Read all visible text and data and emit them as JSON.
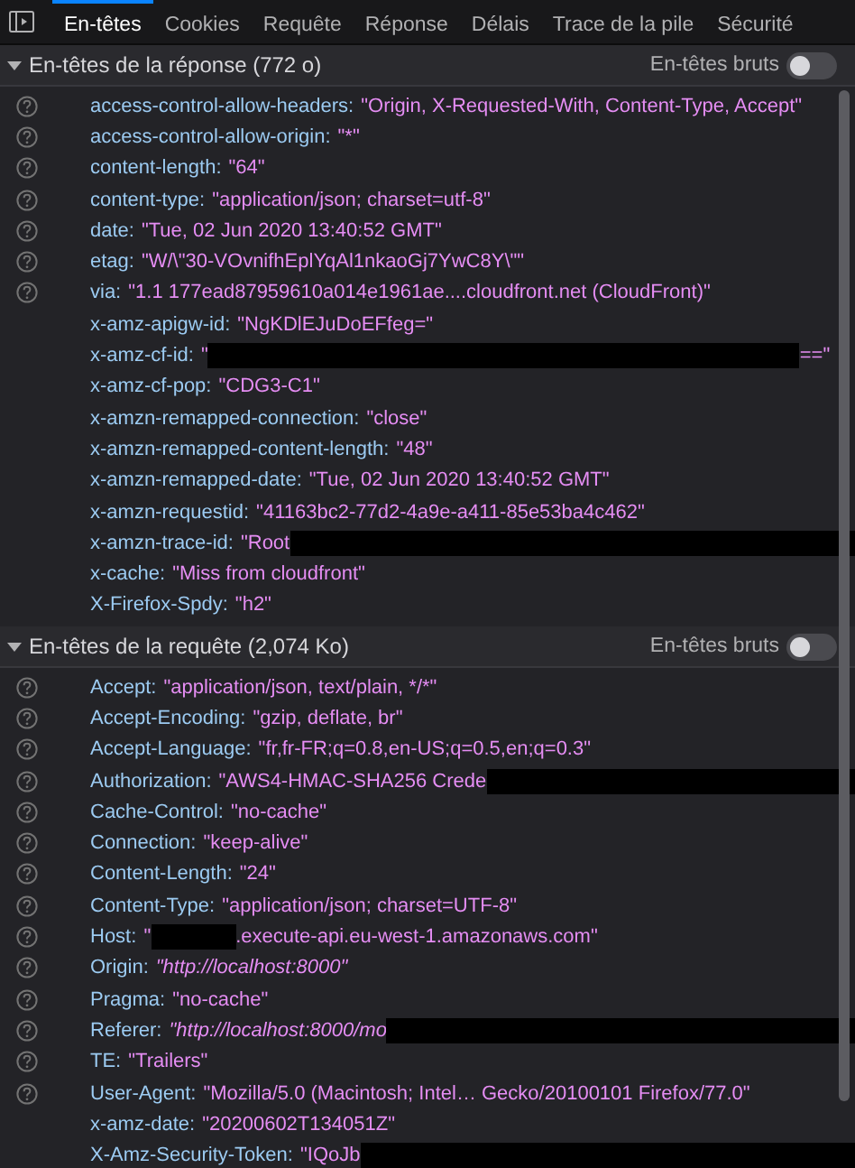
{
  "tabs": [
    {
      "label": "En-têtes",
      "selected": true
    },
    {
      "label": "Cookies",
      "selected": false
    },
    {
      "label": "Requête",
      "selected": false
    },
    {
      "label": "Réponse",
      "selected": false
    },
    {
      "label": "Délais",
      "selected": false
    },
    {
      "label": "Trace de la pile",
      "selected": false
    },
    {
      "label": "Sécurité",
      "selected": false
    }
  ],
  "sections": [
    {
      "title": "En-têtes de la réponse (772 o)",
      "expanded": true,
      "raw_toggle": {
        "label": "En-têtes bruts",
        "on": false
      },
      "headers": [
        {
          "name": "access-control-allow-headers:",
          "value": "\"Origin, X-Requested-With, Content-Type, Accept\"",
          "help": true
        },
        {
          "name": "access-control-allow-origin:",
          "value": "\"*\"",
          "help": true
        },
        {
          "name": "content-length:",
          "value": "\"64\"",
          "help": true
        },
        {
          "name": "content-type:",
          "value": "\"application/json; charset=utf-8\"",
          "help": true
        },
        {
          "name": "date:",
          "value": "\"Tue, 02 Jun 2020 13:40:52 GMT\"",
          "help": true
        },
        {
          "name": "etag:",
          "value": "\"W/\\\"30-VOvnifhEplYqAl1nkaoGj7YwC8Y\\\"\"",
          "help": true
        },
        {
          "name": "via:",
          "value": "\"1.1 177ead87959610a014e1961ae....cloudfront.net (CloudFront)\"",
          "help": true
        },
        {
          "name": "x-amz-apigw-id:",
          "value": "\"NgKDlEJuDoEFfeg=\"",
          "help": false
        },
        {
          "name": "x-amz-cf-id:",
          "value": "\"",
          "kind": "redacted_long",
          "value_tail": "==\"",
          "help": false
        },
        {
          "name": "x-amz-cf-pop:",
          "value": "\"CDG3-C1\"",
          "help": false
        },
        {
          "name": "x-amzn-remapped-connection:",
          "value": "\"close\"",
          "help": false
        },
        {
          "name": "x-amzn-remapped-content-length:",
          "value": "\"48\"",
          "help": false
        },
        {
          "name": "x-amzn-remapped-date:",
          "value": "\"Tue, 02 Jun 2020 13:40:52 GMT\"",
          "help": false
        },
        {
          "name": "x-amzn-requestid:",
          "value": "\"41163bc2-77d2-4a9e-a411-85e53ba4c462\"",
          "help": false
        },
        {
          "name": "x-amzn-trace-id:",
          "value": "\"Root",
          "kind": "redacted_to_edge",
          "help": false
        },
        {
          "name": "x-cache:",
          "value": "\"Miss from cloudfront\"",
          "help": false
        },
        {
          "name": "X-Firefox-Spdy:",
          "value": "\"h2\"",
          "help": false
        }
      ]
    },
    {
      "title": "En-têtes de la requête (2,074 Ko)",
      "expanded": true,
      "raw_toggle": {
        "label": "En-têtes bruts",
        "on": false
      },
      "headers": [
        {
          "name": "Accept:",
          "value": "\"application/json, text/plain, */*\"",
          "help": true
        },
        {
          "name": "Accept-Encoding:",
          "value": "\"gzip, deflate, br\"",
          "help": true
        },
        {
          "name": "Accept-Language:",
          "value": "\"fr,fr-FR;q=0.8,en-US;q=0.5,en;q=0.3\"",
          "help": true
        },
        {
          "name": "Authorization:",
          "value": "\"AWS4-HMAC-SHA256 Crede",
          "kind": "redacted_to_edge",
          "help": true
        },
        {
          "name": "Cache-Control:",
          "value": "\"no-cache\"",
          "help": true
        },
        {
          "name": "Connection:",
          "value": "\"keep-alive\"",
          "help": true
        },
        {
          "name": "Content-Length:",
          "value": "\"24\"",
          "help": true
        },
        {
          "name": "Content-Type:",
          "value": "\"application/json; charset=UTF-8\"",
          "help": true
        },
        {
          "name": "Host:",
          "value": "\"",
          "kind": "redacted_short",
          "value_tail": ".execute-api.eu-west-1.amazonaws.com\"",
          "help": true
        },
        {
          "name": "Origin:",
          "value": "\"http://localhost:8000\"",
          "italic": true,
          "help": true
        },
        {
          "name": "Pragma:",
          "value": "\"no-cache\"",
          "help": true
        },
        {
          "name": "Referer:",
          "value": "\"http://localhost:8000/mo",
          "italic": true,
          "kind": "redacted_to_edge",
          "help": true
        },
        {
          "name": "TE:",
          "value": "\"Trailers\"",
          "help": true
        },
        {
          "name": "User-Agent:",
          "value": "\"Mozilla/5.0 (Macintosh; Intel… Gecko/20100101 Firefox/77.0\"",
          "help": true
        },
        {
          "name": "x-amz-date:",
          "value": "\"20200602T134051Z\"",
          "help": false
        },
        {
          "name": "X-Amz-Security-Token:",
          "value": "\"IQoJb",
          "kind": "redacted_to_edge",
          "help": false
        }
      ]
    }
  ]
}
